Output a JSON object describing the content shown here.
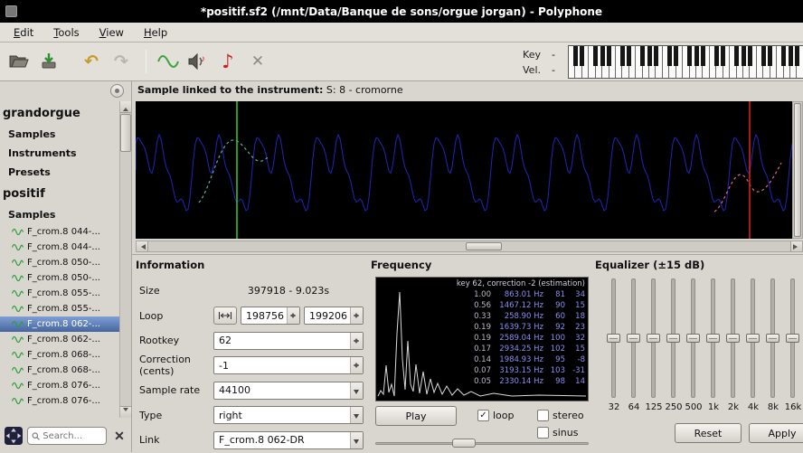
{
  "window": {
    "title": "*positif.sf2 (/mnt/Data/Banque de sons/orgue jorgan) - Polyphone"
  },
  "menu": {
    "items": [
      "Edit",
      "Tools",
      "View",
      "Help"
    ]
  },
  "toolbar": {
    "key_label": "Key",
    "key_value": "-",
    "vel_label": "Vel.",
    "vel_value": "-"
  },
  "icons": {
    "undo": "↶",
    "redo": "↷",
    "music_note": "♪",
    "close": "✕",
    "check": "✓",
    "clear": "✕"
  },
  "sidebar": {
    "tree_top": [
      {
        "label": "grandorgue",
        "kind": "root"
      },
      {
        "label": "Samples",
        "kind": "section"
      },
      {
        "label": "Instruments",
        "kind": "section"
      },
      {
        "label": "Presets",
        "kind": "section"
      },
      {
        "label": "positif",
        "kind": "root"
      },
      {
        "label": "Samples",
        "kind": "section"
      }
    ],
    "samples": [
      "F_crom.8 044-...",
      "F_crom.8 044-...",
      "F_crom.8 050-...",
      "F_crom.8 050-...",
      "F_crom.8 055-...",
      "F_crom.8 055-...",
      "F_crom.8 062-...",
      "F_crom.8 062-...",
      "F_crom.8 068-...",
      "F_crom.8 068-...",
      "F_crom.8 076-...",
      "F_crom.8 076-..."
    ],
    "selected_index": 6,
    "search_placeholder": "Search..."
  },
  "sample_header": {
    "prefix": "Sample linked to the instrument:",
    "value": "S: 8 - cromorne"
  },
  "information": {
    "title": "Information",
    "size_label": "Size",
    "size_value": "397918 - 9.023s",
    "loop_label": "Loop",
    "loop_start": "198756",
    "loop_end": "199206",
    "rootkey_label": "Rootkey",
    "rootkey_value": "62",
    "correction_label": "Correction (cents)",
    "correction_value": "-1",
    "sample_rate_label": "Sample rate",
    "sample_rate_value": "44100",
    "type_label": "Type",
    "type_value": "right",
    "link_label": "Link",
    "link_value": "F_crom.8 062-DR"
  },
  "frequency": {
    "title": "Frequency",
    "overlay_header": "key 62, correction -2 (estimation)",
    "rows": [
      [
        "1.00",
        "863.01 Hz",
        "81",
        "34"
      ],
      [
        "0.56",
        "1467.12 Hz",
        "90",
        "15"
      ],
      [
        "0.33",
        "258.90 Hz",
        "60",
        "18"
      ],
      [
        "0.19",
        "1639.73 Hz",
        "92",
        "23"
      ],
      [
        "0.19",
        "2589.04 Hz",
        "100",
        "32"
      ],
      [
        "0.17",
        "2934.25 Hz",
        "102",
        "15"
      ],
      [
        "0.14",
        "1984.93 Hz",
        "95",
        "-8"
      ],
      [
        "0.07",
        "3193.15 Hz",
        "103",
        "-31"
      ],
      [
        "0.05",
        "2330.14 Hz",
        "98",
        "14"
      ]
    ],
    "play_label": "Play",
    "loop_label": "loop",
    "stereo_label": "stereo",
    "sinus_label": "sinus",
    "loop_checked": true
  },
  "equalizer": {
    "title": "Equalizer (±15 dB)",
    "bands": [
      "32",
      "64",
      "125",
      "250",
      "500",
      "1k",
      "2k",
      "4k",
      "8k",
      "16k"
    ],
    "reset_label": "Reset",
    "apply_label": "Apply"
  },
  "colors": {
    "waveform": "#2323bb",
    "loop_start_marker": "#33cc33",
    "loop_end_marker": "#dd2222",
    "selection": "#45659f"
  }
}
